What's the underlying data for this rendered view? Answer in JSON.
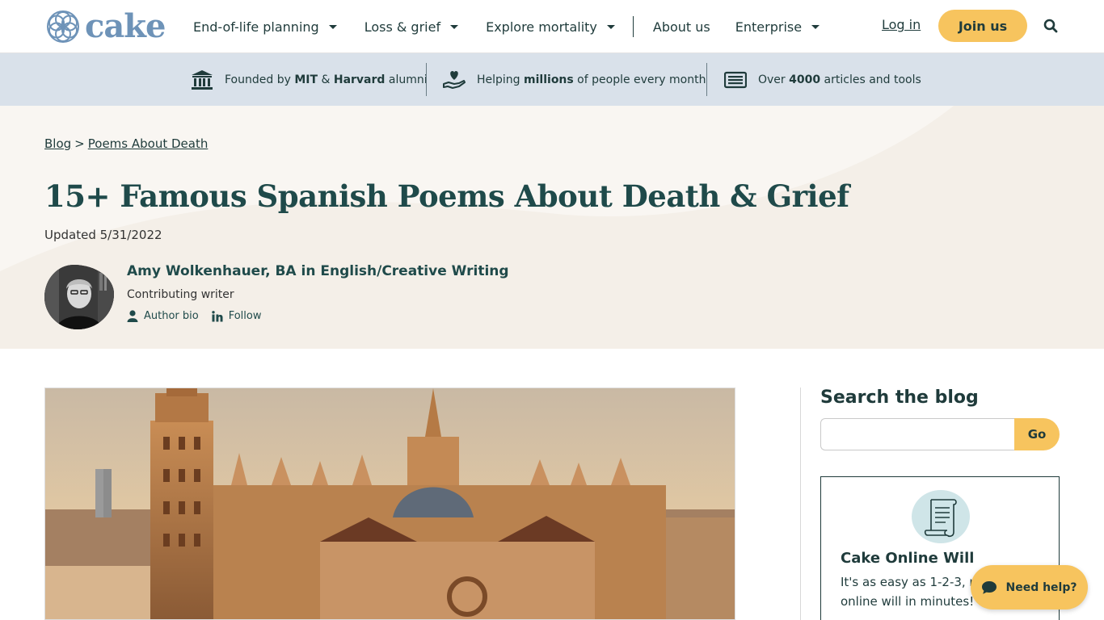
{
  "header": {
    "logo_text": "cake",
    "nav": [
      {
        "label": "End-of-life planning",
        "has_dropdown": true
      },
      {
        "label": "Loss & grief",
        "has_dropdown": true
      },
      {
        "label": "Explore mortality",
        "has_dropdown": true
      },
      {
        "label": "About us",
        "has_dropdown": false
      },
      {
        "label": "Enterprise",
        "has_dropdown": true
      }
    ],
    "login_label": "Log in",
    "join_label": "Join us"
  },
  "trust_bar": {
    "items": [
      {
        "icon": "institution-icon",
        "pre": "Founded by ",
        "b1": "MIT",
        "mid": " & ",
        "b2": "Harvard",
        "post": " alumni"
      },
      {
        "icon": "heart-hand-icon",
        "pre": "Helping ",
        "b1": "millions",
        "post": " of people every month"
      },
      {
        "icon": "newspaper-icon",
        "pre": "Over ",
        "b1": "4000",
        "post": " articles and tools"
      }
    ]
  },
  "breadcrumb": {
    "items": [
      "Blog",
      "Poems About Death"
    ],
    "separator": ">"
  },
  "article": {
    "title": "15+ Famous Spanish Poems About Death & Grief",
    "updated": "Updated 5/31/2022",
    "author": {
      "name": "Amy Wolkenhauer, BA in English/Creative Writing",
      "role": "Contributing writer",
      "bio_label": "Author bio",
      "follow_label": "Follow"
    }
  },
  "sidebar": {
    "search_title": "Search the blog",
    "search_value": "",
    "search_button": "Go",
    "promo_title": "Cake Online Will",
    "promo_text": "It's as easy as 1-2-3, n online will in minutes!"
  },
  "help_button": "Need help?",
  "colors": {
    "brand_dark": "#1f3b3b",
    "accent_yellow": "#f7c45e",
    "trust_bg": "#d9e1ea",
    "hero_bg": "#f9f6f2",
    "logo_blue": "#6e93b8"
  }
}
